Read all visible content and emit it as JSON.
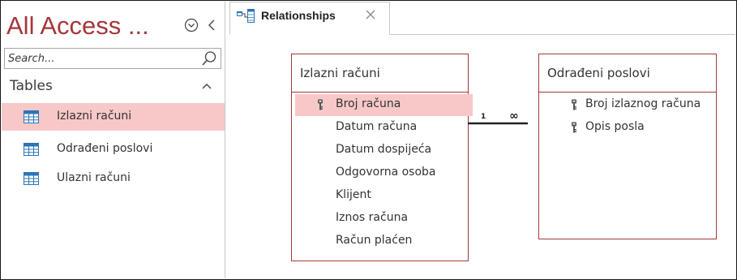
{
  "nav": {
    "title": "All Access ...",
    "search_placeholder": "Search...",
    "group_label": "Tables",
    "items": [
      {
        "label": "Izlazni računi",
        "selected": true
      },
      {
        "label": "Odrađeni poslovi",
        "selected": false
      },
      {
        "label": "Ulazni računi",
        "selected": false
      }
    ]
  },
  "tab": {
    "label": "Relationships"
  },
  "tables": [
    {
      "title": "Izlazni računi",
      "fields": [
        {
          "label": "Broj računa",
          "key": true,
          "selected": true
        },
        {
          "label": "Datum računa",
          "key": false,
          "selected": false
        },
        {
          "label": "Datum dospijeća",
          "key": false,
          "selected": false
        },
        {
          "label": "Odgovorna osoba",
          "key": false,
          "selected": false
        },
        {
          "label": "Klijent",
          "key": false,
          "selected": false
        },
        {
          "label": "Iznos računa",
          "key": false,
          "selected": false
        },
        {
          "label": "Račun plaćen",
          "key": false,
          "selected": false
        }
      ]
    },
    {
      "title": "Odrađeni poslovi",
      "fields": [
        {
          "label": "Broj izlaznog računa",
          "key": true,
          "selected": false
        },
        {
          "label": "Opis posla",
          "key": true,
          "selected": false
        }
      ]
    }
  ],
  "relationship": {
    "one_label": "1",
    "many_label": "∞"
  },
  "colors": {
    "accent": "#a4373a",
    "selection": "#f8c8c8",
    "table_icon": "#2e75b6"
  }
}
